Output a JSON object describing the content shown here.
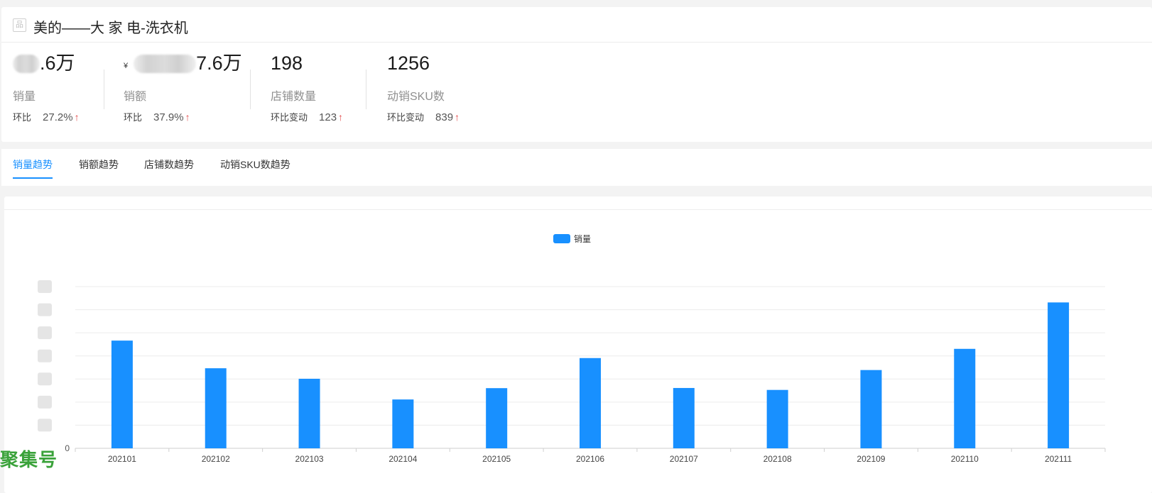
{
  "header": {
    "title": "美的——大 家 电-洗衣机",
    "icon": "image-placeholder-icon"
  },
  "metrics": [
    {
      "value_visible": ".6万",
      "currency": "",
      "label": "销量",
      "change_label": "环比",
      "change_value": "27.2%",
      "trend": "up"
    },
    {
      "value_visible": "7.6万",
      "currency": "¥",
      "label": "销额",
      "change_label": "环比",
      "change_value": "37.9%",
      "trend": "up"
    },
    {
      "value_visible": "198",
      "currency": "",
      "label": "店铺数量",
      "change_label": "环比变动",
      "change_value": "123",
      "trend": "up"
    },
    {
      "value_visible": "1256",
      "currency": "",
      "label": "动销SKU数",
      "change_label": "环比变动",
      "change_value": "839",
      "trend": "up"
    }
  ],
  "tabs": [
    {
      "label": "销量趋势",
      "active": true
    },
    {
      "label": "销额趋势",
      "active": false
    },
    {
      "label": "店铺数趋势",
      "active": false
    },
    {
      "label": "动销SKU数趋势",
      "active": false
    }
  ],
  "colors": {
    "accent": "#1890ff",
    "up": "#e24d4d"
  },
  "chart_data": {
    "type": "bar",
    "legend": [
      "销量"
    ],
    "legend_position": "top-center",
    "categories": [
      "202101",
      "202102",
      "202103",
      "202104",
      "202105",
      "202106",
      "202107",
      "202108",
      "202109",
      "202110",
      "202111"
    ],
    "y_ticks": [
      "",
      "",
      "",
      "",
      "",
      "",
      "",
      "0"
    ],
    "value_fraction_of_axis_max": [
      0.666,
      0.495,
      0.43,
      0.302,
      0.372,
      0.558,
      0.373,
      0.361,
      0.484,
      0.615,
      0.902
    ],
    "grid": true
  },
  "watermark": "聚集号"
}
